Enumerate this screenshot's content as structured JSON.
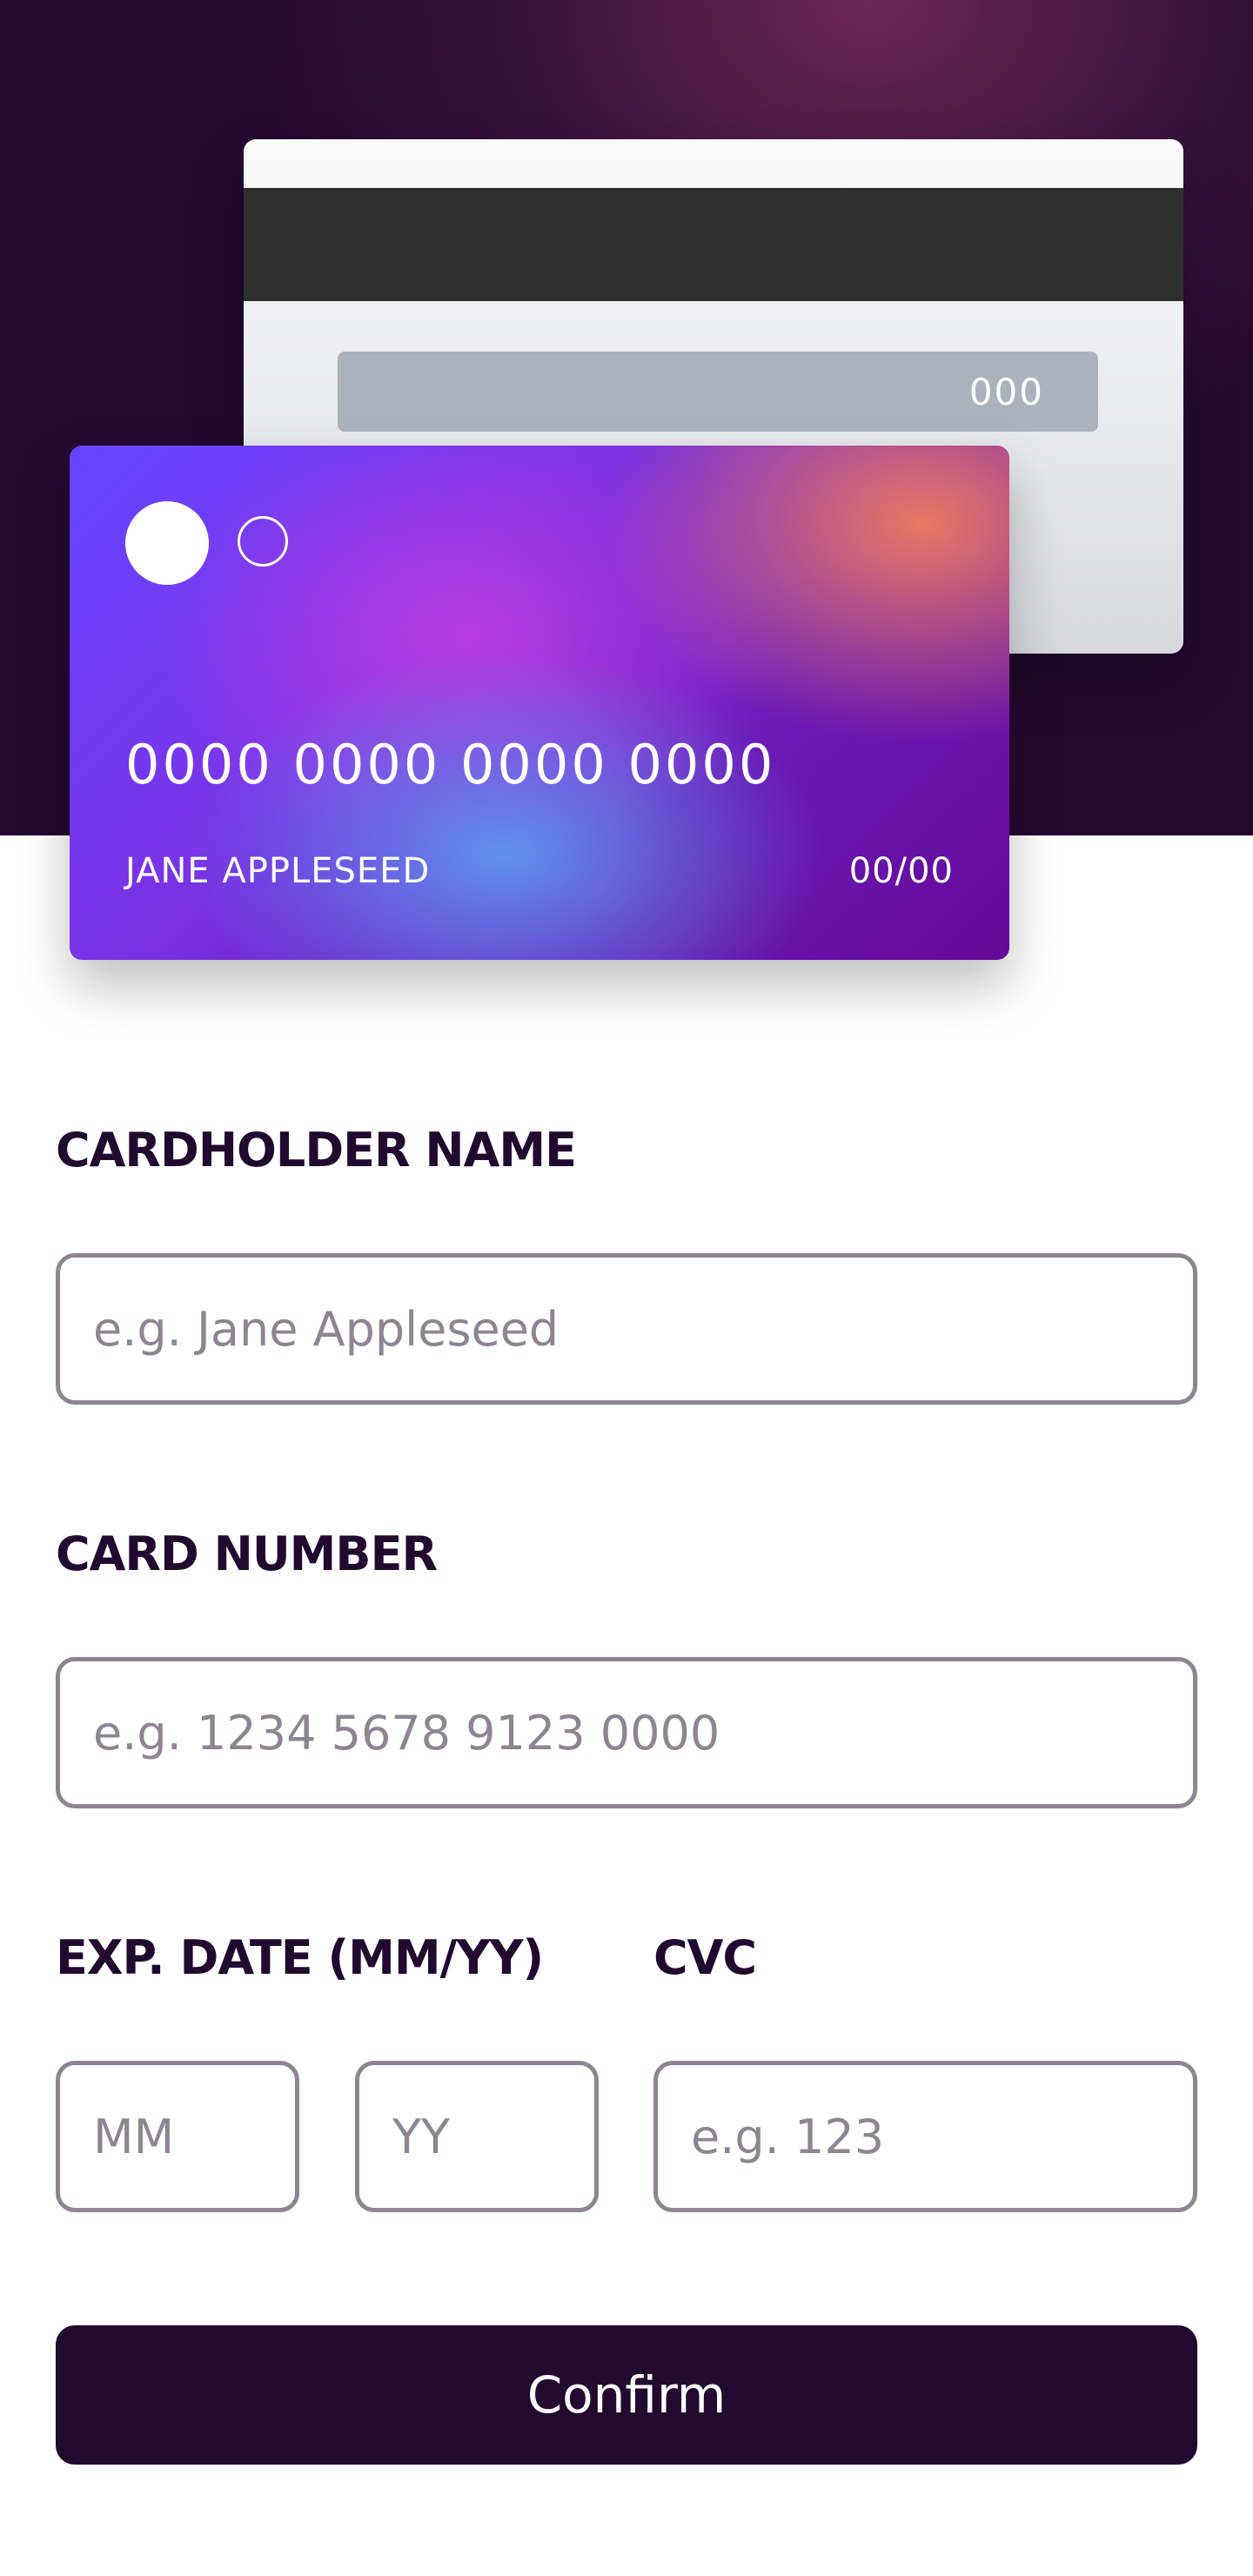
{
  "card_back": {
    "cvc_display": "000"
  },
  "card_front": {
    "number_display": "0000 0000 0000 0000",
    "name_display": "JANE APPLESEED",
    "expiry_display": "00/00"
  },
  "form": {
    "cardholder_label": "CARDHOLDER NAME",
    "cardholder_placeholder": "e.g. Jane Appleseed",
    "cardholder_value": "",
    "number_label": "CARD NUMBER",
    "number_placeholder": "e.g. 1234 5678 9123 0000",
    "number_value": "",
    "exp_label": "EXP. DATE (MM/YY)",
    "month_placeholder": "MM",
    "month_value": "",
    "year_placeholder": "YY",
    "year_value": "",
    "cvc_label": "CVC",
    "cvc_placeholder": "e.g. 123",
    "cvc_value": "",
    "confirm_label": "Confirm"
  },
  "colors": {
    "dark_violet": "#21092f",
    "border_gray": "#8e8593",
    "hero_background": "#23092f"
  }
}
